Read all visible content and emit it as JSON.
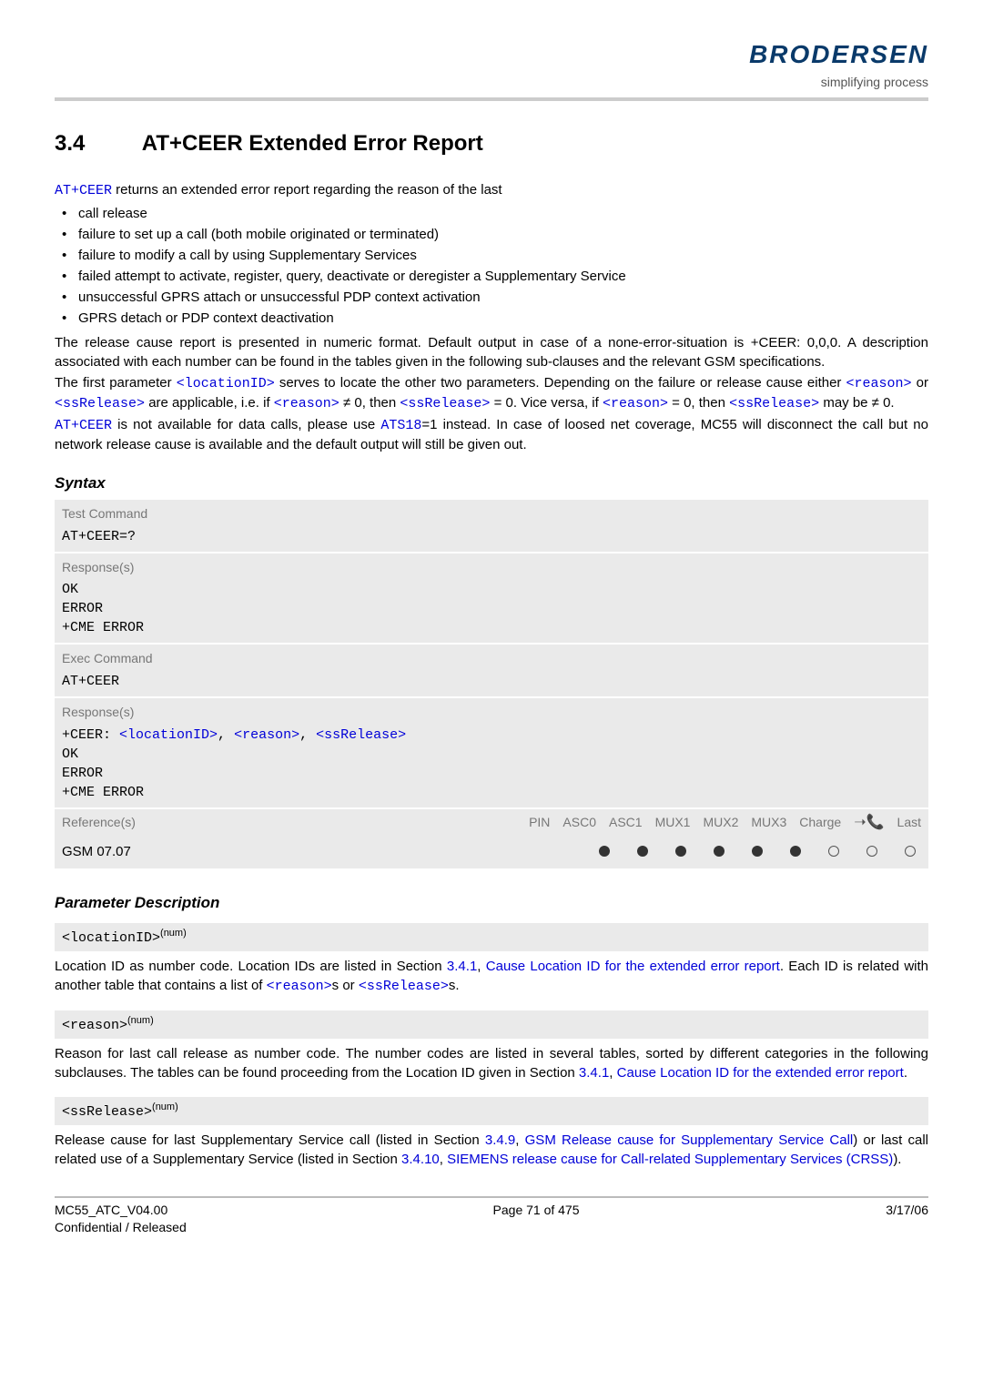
{
  "logo": {
    "brand": "BRODERSEN",
    "tagline": "simplifying process"
  },
  "section": {
    "number": "3.4",
    "title": "AT+CEER   Extended Error Report"
  },
  "intro": {
    "lead_cmd": "AT+CEER",
    "lead_rest": " returns an extended error report regarding the reason of the last",
    "bullets": [
      "call release",
      "failure to set up a call (both mobile originated or terminated)",
      "failure to modify a call by using Supplementary Services",
      "failed attempt to activate, register, query, deactivate or deregister a Supplementary Service",
      "unsuccessful GPRS attach or unsuccessful PDP context activation",
      "GPRS detach or PDP context deactivation"
    ],
    "p1": "The release cause report is presented in numeric format. Default output in case of a none-error-situation is +CEER: 0,0,0. A description associated with each number can be found in the tables given in the following sub-clauses and the relevant GSM specifications.",
    "p2a": "The first parameter ",
    "p2_loc": "<locationID>",
    "p2b": " serves to locate the other two parameters. Depending on the failure or release cause either ",
    "p2_reason": "<reason>",
    "p2c": " or ",
    "p2_ss": "<ssRelease>",
    "p2d": " are applicable, i.e. if ",
    "p2_reason2": "<reason>",
    "p2e": " ≠ 0, then ",
    "p2_ss2": "<ssRelease>",
    "p2f": " = 0. Vice versa, if ",
    "p2_reason3": "<reason>",
    "p2g": " = 0, then ",
    "p2_ss3": "<ssRelease>",
    "p2h": " may be ≠ 0.",
    "p3_cmd": "AT+CEER",
    "p3a": " is not available for data calls, please use ",
    "p3_ats": "ATS18",
    "p3b": "=1 instead. In case of loosed net coverage, MC55 will disconnect the call but no network release cause is available and the default output will still be given out."
  },
  "syntax": {
    "heading": "Syntax",
    "test_label": "Test Command",
    "test_cmd": "AT+CEER=?",
    "resp_label": "Response(s)",
    "resp1": "OK\nERROR\n+CME ERROR",
    "exec_label": "Exec Command",
    "exec_cmd": "AT+CEER",
    "resp2_pre": "+CEER: ",
    "resp2_loc": "<locationID>",
    "resp2_reason": "<reason>",
    "resp2_ss": "<ssRelease>",
    "resp2_tail": "OK\nERROR\n+CME ERROR",
    "ref_label": "Reference(s)",
    "ref_cols": [
      "PIN",
      "ASC0",
      "ASC1",
      "MUX1",
      "MUX2",
      "MUX3",
      "Charge",
      "",
      "Last"
    ],
    "ref_value": "GSM 07.07",
    "ref_dots": [
      "f",
      "f",
      "f",
      "f",
      "f",
      "f",
      "o",
      "o",
      "o"
    ]
  },
  "params": {
    "heading": "Parameter Description",
    "loc_name": "<locationID>",
    "loc_sup": "(num)",
    "loc_body_a": "Location ID as number code. Location IDs are listed in Section ",
    "loc_link1": "3.4.1",
    "loc_body_b": ", ",
    "loc_link2": "Cause Location ID for the extended error report",
    "loc_body_c": ". Each ID is related with another table that contains a list of ",
    "loc_reason": "<reason>",
    "loc_body_d": "s or ",
    "loc_ss": "<ssRelease>",
    "loc_body_e": "s.",
    "reason_name": "<reason>",
    "reason_sup": "(num)",
    "reason_body_a": "Reason for last call release as number code. The number codes are listed in several tables, sorted by different categories in the following subclauses. The tables can be found proceeding from the Location ID given in Section ",
    "reason_link1": "3.4.1",
    "reason_body_b": ", ",
    "reason_link2": "Cause Location ID for the extended error report",
    "reason_body_c": ".",
    "ss_name": "<ssRelease>",
    "ss_sup": "(num)",
    "ss_body_a": "Release cause for last Supplementary Service call (listed in Section ",
    "ss_link1": "3.4.9",
    "ss_body_b": ", ",
    "ss_link2": "GSM Release cause for Supplementary Service Call",
    "ss_body_c": ") or last call related use of a Supplementary Service (listed in Section ",
    "ss_link3": "3.4.10",
    "ss_body_d": ", ",
    "ss_link4": "SIEMENS release cause for Call-related Supplementary Services (CRSS)",
    "ss_body_e": ")."
  },
  "footer": {
    "left1": "MC55_ATC_V04.00",
    "left2": "Confidential / Released",
    "center": "Page 71 of 475",
    "right": "3/17/06"
  }
}
